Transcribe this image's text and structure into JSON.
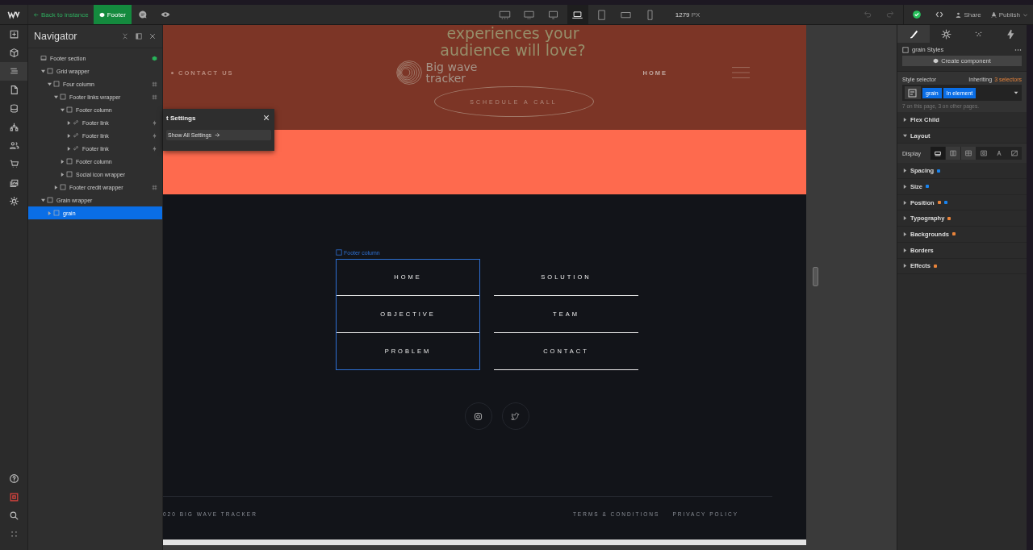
{
  "topbar": {
    "back_link": "Back to instance",
    "component_button": "Footer",
    "breakpoints": [
      {
        "kind": "xxl",
        "selected": false
      },
      {
        "kind": "xl",
        "selected": false
      },
      {
        "kind": "l",
        "selected": false
      },
      {
        "kind": "base",
        "selected": true
      },
      {
        "kind": "tablet",
        "selected": false
      },
      {
        "kind": "landscape",
        "selected": false
      },
      {
        "kind": "portrait",
        "selected": false
      }
    ],
    "width_value": "1279",
    "width_unit": "PX",
    "share": "Share",
    "publish": "Publish"
  },
  "left_rail": [
    {
      "kind": "add",
      "selected": false
    },
    {
      "kind": "box",
      "selected": false
    },
    {
      "kind": "navigator",
      "selected": true
    },
    {
      "kind": "pages",
      "selected": false
    },
    {
      "kind": "cms",
      "selected": false
    },
    {
      "kind": "tree",
      "selected": false
    },
    {
      "kind": "users",
      "selected": false
    },
    {
      "kind": "cart",
      "selected": false
    },
    {
      "kind": "assets",
      "selected": false
    },
    {
      "kind": "settings",
      "selected": false
    }
  ],
  "left_rail_bottom": [
    {
      "kind": "help"
    },
    {
      "kind": "record"
    },
    {
      "kind": "search"
    },
    {
      "kind": "apps"
    }
  ],
  "navigator": {
    "title": "Navigator",
    "tree": [
      {
        "label": "Footer section",
        "kind": "section",
        "badge": {
          "kind": "component"
        },
        "selected": false,
        "children": [
          {
            "label": "Grid wrapper",
            "kind": "box",
            "expanded": true,
            "selected": false,
            "children": [
              {
                "label": "Four column",
                "kind": "box",
                "expanded": true,
                "badge": {
                  "kind": "grid"
                },
                "selected": false,
                "children": [
                  {
                    "label": "Footer links wrapper",
                    "kind": "box",
                    "expanded": true,
                    "badge": {
                      "kind": "grid"
                    },
                    "selected": false,
                    "children": [
                      {
                        "label": "Footer column",
                        "kind": "box",
                        "expanded": true,
                        "selected": false,
                        "children": [
                          {
                            "label": "Footer link",
                            "kind": "link",
                            "expanded": false,
                            "badge": {
                              "kind": "interaction"
                            },
                            "selected": false
                          },
                          {
                            "label": "Footer link",
                            "kind": "link",
                            "expanded": false,
                            "badge": {
                              "kind": "interaction"
                            },
                            "selected": false
                          },
                          {
                            "label": "Footer link",
                            "kind": "link",
                            "expanded": false,
                            "badge": {
                              "kind": "interaction"
                            },
                            "selected": false
                          }
                        ]
                      },
                      {
                        "label": "Footer column",
                        "kind": "box",
                        "expanded": false,
                        "selected": false
                      },
                      {
                        "label": "Social icon wrapper",
                        "kind": "box",
                        "expanded": false,
                        "selected": false
                      }
                    ]
                  },
                  {
                    "label": "Footer credit wrapper",
                    "kind": "box",
                    "expanded": false,
                    "badge": {
                      "kind": "grid"
                    },
                    "selected": false
                  }
                ]
              }
            ]
          },
          {
            "label": "Grain wrapper",
            "kind": "box",
            "expanded": true,
            "selected": false,
            "children": [
              {
                "label": "grain",
                "kind": "box",
                "expanded": false,
                "selected": true
              }
            ]
          }
        ]
      }
    ]
  },
  "settings_popup": {
    "title": "t Settings",
    "button": "Show All Settings"
  },
  "page": {
    "heading": [
      "experiences your",
      "audience will love?"
    ],
    "nav_left": "CONTACT US",
    "logo": [
      "Big wave",
      "tracker"
    ],
    "nav_right": "HOME",
    "cta": "SCHEDULE A CALL",
    "selection_label": "Footer column",
    "footer_columns": [
      {
        "selected": true,
        "links": [
          "HOME",
          "OBJECTIVE",
          "PROBLEM"
        ]
      },
      {
        "selected": false,
        "links": [
          "SOLUTION",
          "TEAM",
          "CONTACT"
        ]
      }
    ],
    "social": [
      {
        "kind": "instagram"
      },
      {
        "kind": "twitter"
      }
    ],
    "copyright": "020 BIG WAVE TRACKER",
    "legal_links": [
      "TERMS & CONDITIONS",
      "PRIVACY POLICY"
    ]
  },
  "style_panel": {
    "tabs": [
      {
        "kind": "style",
        "selected": true
      },
      {
        "kind": "settings",
        "selected": false
      },
      {
        "kind": "interactions-dots",
        "selected": false
      },
      {
        "kind": "bolt",
        "selected": false
      }
    ],
    "element_title": "grain Styles",
    "create_component": "Create component",
    "selector_label": "Style selector",
    "inheriting": "Inheriting",
    "inheriting_count": "3 selectors",
    "chips": [
      "grain",
      "In element"
    ],
    "usage_note": "7 on this page, 3 on other pages.",
    "sections": [
      {
        "label": "Flex Child",
        "expanded": false
      },
      {
        "label": "Layout",
        "expanded": true
      }
    ],
    "display_label": "Display",
    "display_options": [
      {
        "kind": "block",
        "selected": true
      },
      {
        "kind": "flex",
        "selected": false
      },
      {
        "kind": "grid",
        "selected": false
      },
      {
        "kind": "inline-block",
        "selected": false
      },
      {
        "kind": "inline",
        "selected": false
      },
      {
        "kind": "none",
        "selected": false
      }
    ],
    "more_sections": [
      {
        "label": "Spacing",
        "expanded": false,
        "dots": [
          {
            "color": "#1a84f0"
          }
        ]
      },
      {
        "label": "Size",
        "expanded": false,
        "dots": [
          {
            "color": "#1a84f0"
          }
        ]
      },
      {
        "label": "Position",
        "expanded": false,
        "dots": [
          {
            "color": "#e8833a"
          },
          {
            "color": "#1a84f0"
          }
        ]
      },
      {
        "label": "Typography",
        "expanded": false,
        "dots": [
          {
            "color": "#e8833a"
          }
        ]
      },
      {
        "label": "Backgrounds",
        "expanded": false,
        "dots": [
          {
            "color": "#e8833a"
          }
        ]
      },
      {
        "label": "Borders",
        "expanded": false
      },
      {
        "label": "Effects",
        "expanded": false,
        "dots": [
          {
            "color": "#e8833a"
          }
        ]
      }
    ]
  }
}
